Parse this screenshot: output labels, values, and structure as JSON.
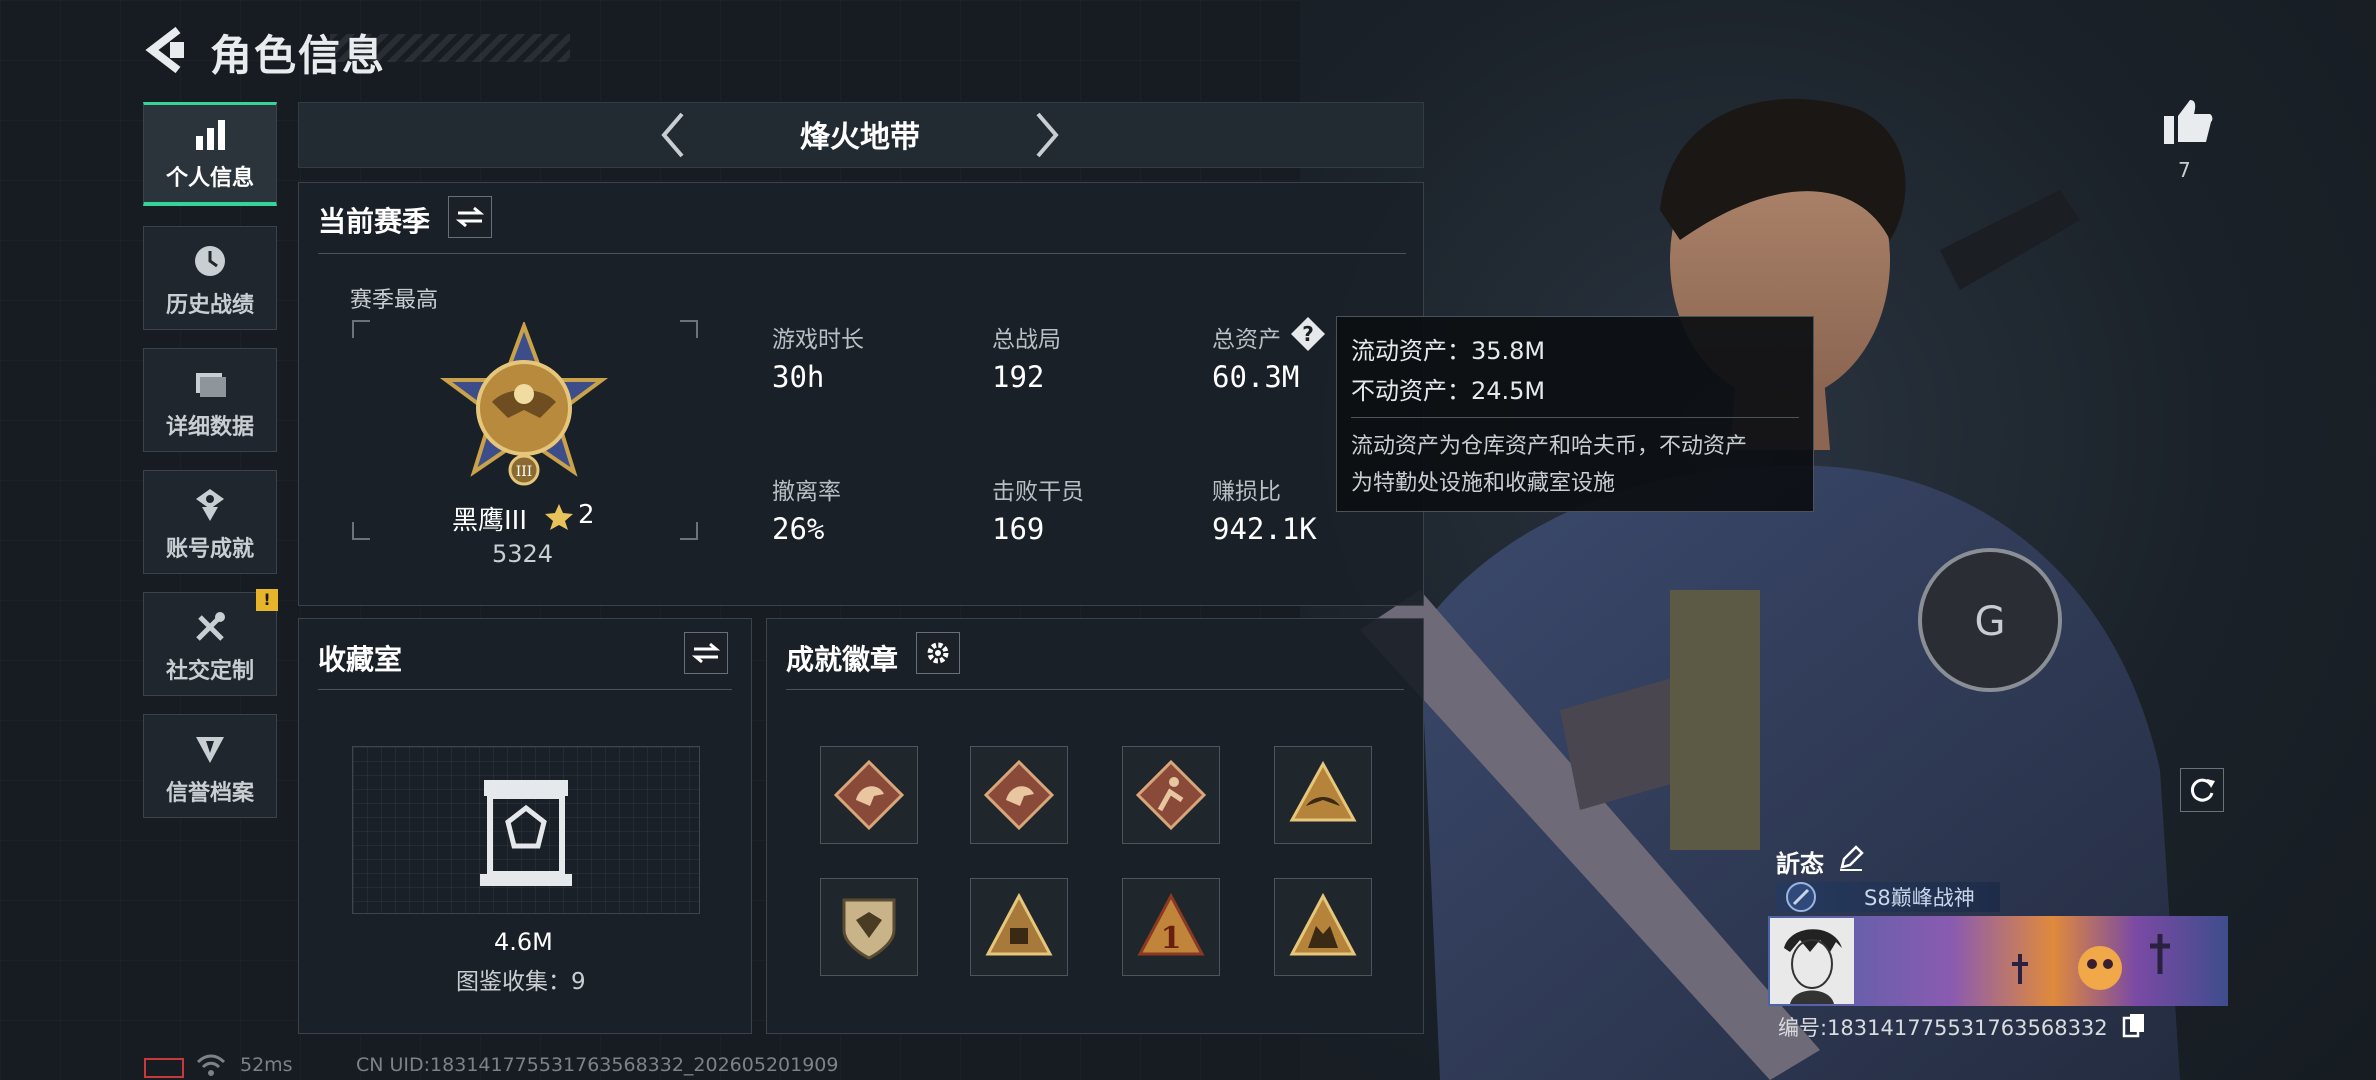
{
  "header": {
    "title": "角色信息",
    "back_icon": "back-arrow-icon"
  },
  "nav": {
    "items": [
      {
        "label": "个人信息",
        "icon": "bar-chart-icon",
        "active": true
      },
      {
        "label": "历史战绩",
        "icon": "clock-icon"
      },
      {
        "label": "详细数据",
        "icon": "folder-icon"
      },
      {
        "label": "账号成就",
        "icon": "medal-icon"
      },
      {
        "label": "社交定制",
        "icon": "tools-icon",
        "badge": "!"
      },
      {
        "label": "信誉档案",
        "icon": "shield-icon"
      }
    ]
  },
  "mode": {
    "title": "烽火地带"
  },
  "season": {
    "section_title": "当前赛季",
    "best_label": "赛季最高",
    "rank_name": "黑鹰III",
    "rank_stars": "2",
    "rank_points": "5324",
    "stats": [
      {
        "label": "游戏时长",
        "value": "30h"
      },
      {
        "label": "总战局",
        "value": "192"
      },
      {
        "label": "总资产",
        "value": "60.3M"
      },
      {
        "label": "撤离率",
        "value": "26%"
      },
      {
        "label": "击败干员",
        "value": "169"
      },
      {
        "label": "赚损比",
        "value": "942.1K"
      }
    ]
  },
  "tooltip": {
    "liquid": "流动资产：35.8M",
    "fixed": "不动资产：24.5M",
    "desc_line1": "流动资产为仓库资产和哈夫币，不动资产",
    "desc_line2": "为特勤处设施和收藏室设施"
  },
  "collection": {
    "title": "收藏室",
    "value": "4.6M",
    "count_text": "图鉴收集：9"
  },
  "achievements": {
    "title": "成就徽章",
    "badges": [
      "dragon-badge-icon",
      "dragon-badge-icon",
      "runner-badge-icon",
      "eagle-badge-icon",
      "shield-badge-icon",
      "pyramid-badge-icon",
      "number-one-badge-icon",
      "wolf-badge-icon"
    ]
  },
  "player": {
    "likes": "7",
    "name": "訢态",
    "title_tag": "S8巅峰战神",
    "uid_text": "编号:183141775531763568332"
  },
  "footer": {
    "ping": "52ms",
    "uid_line": "CN UID:183141775531763568332_202605201909"
  },
  "colors": {
    "accent_green": "#35d49b",
    "badge_yellow": "#e6b52a",
    "gold": "#c9a24a"
  }
}
